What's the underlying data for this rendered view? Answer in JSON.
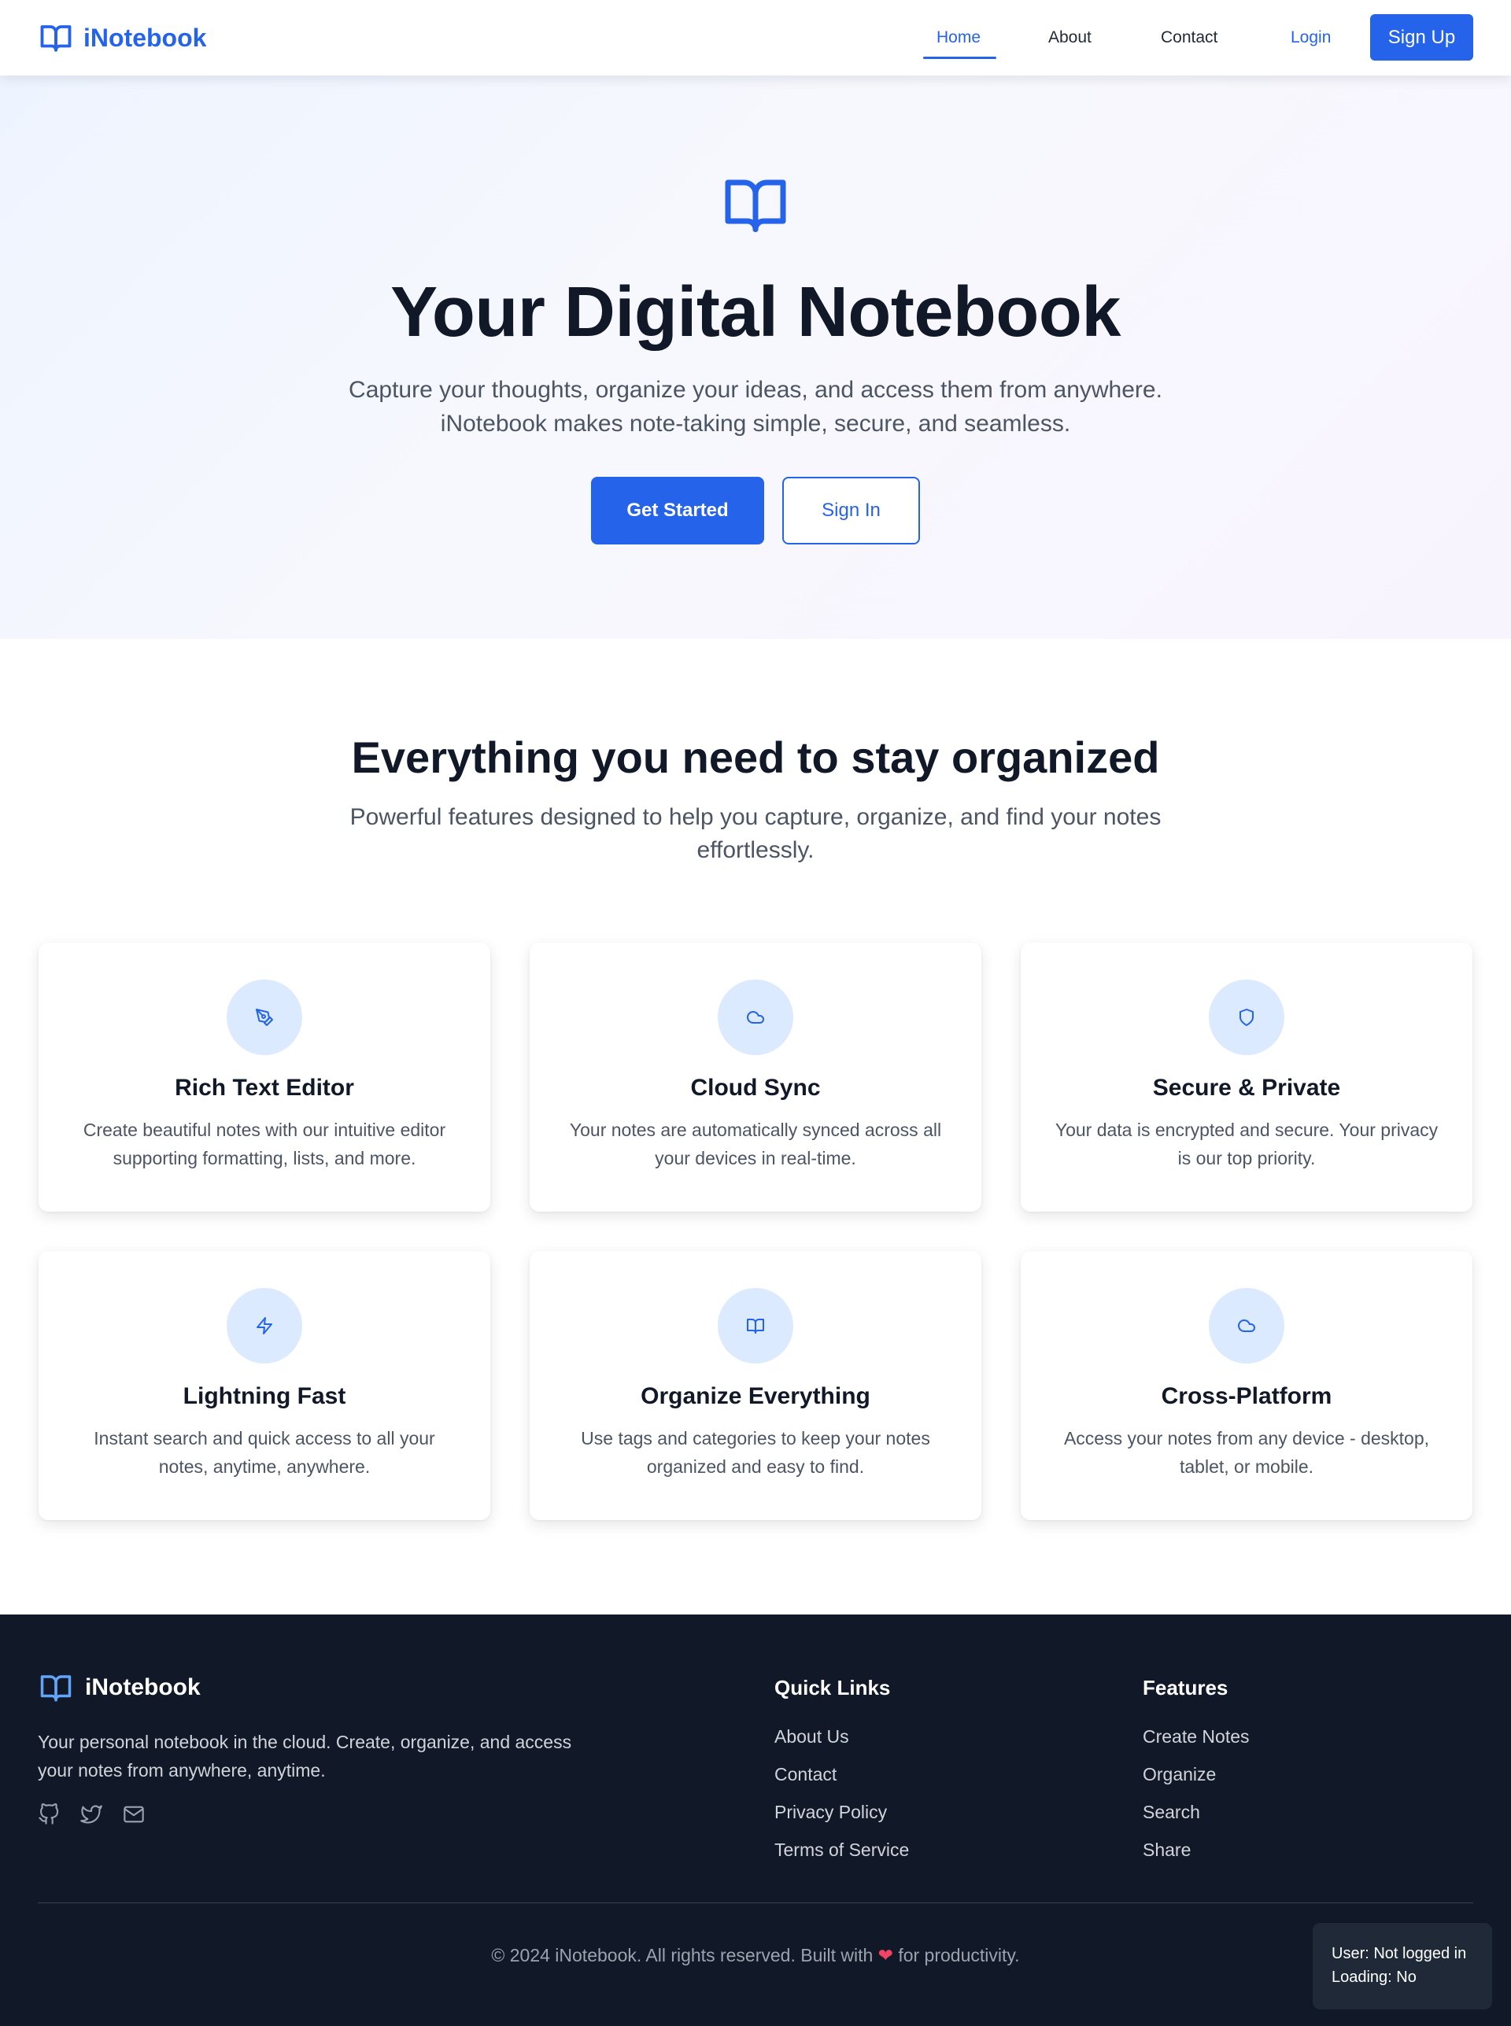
{
  "nav": {
    "brand": "iNotebook",
    "links": [
      {
        "label": "Home",
        "active": true
      },
      {
        "label": "About",
        "active": false
      },
      {
        "label": "Contact",
        "active": false
      }
    ],
    "login_label": "Login",
    "signup_label": "Sign Up"
  },
  "hero": {
    "icon": "book-open-icon",
    "title": "Your Digital Notebook",
    "subtitle_line1": "Capture your thoughts, organize your ideas, and access them from anywhere.",
    "subtitle_line2": "iNotebook makes note-taking simple, secure, and seamless.",
    "primary_button": "Get Started",
    "secondary_button": "Sign In"
  },
  "features": {
    "title": "Everything you need to stay organized",
    "subtitle": "Powerful features designed to help you capture, organize, and find your notes effortlessly.",
    "cards": [
      {
        "icon": "pen-tool-icon",
        "title": "Rich Text Editor",
        "description": "Create beautiful notes with our intuitive editor supporting formatting, lists, and more."
      },
      {
        "icon": "cloud-icon",
        "title": "Cloud Sync",
        "description": "Your notes are automatically synced across all your devices in real-time."
      },
      {
        "icon": "shield-icon",
        "title": "Secure & Private",
        "description": "Your data is encrypted and secure. Your privacy is our top priority."
      },
      {
        "icon": "zap-icon",
        "title": "Lightning Fast",
        "description": "Instant search and quick access to all your notes, anytime, anywhere."
      },
      {
        "icon": "book-open-icon",
        "title": "Organize Everything",
        "description": "Use tags and categories to keep your notes organized and easy to find."
      },
      {
        "icon": "cloud-icon",
        "title": "Cross-Platform",
        "description": "Access your notes from any device - desktop, tablet, or mobile."
      }
    ]
  },
  "footer": {
    "brand": "iNotebook",
    "description": "Your personal notebook in the cloud. Create, organize, and access your notes from anywhere, anytime.",
    "social": [
      "github-icon",
      "twitter-icon",
      "mail-icon"
    ],
    "quick_links": {
      "title": "Quick Links",
      "items": [
        "About Us",
        "Contact",
        "Privacy Policy",
        "Terms of Service"
      ]
    },
    "features": {
      "title": "Features",
      "items": [
        "Create Notes",
        "Organize",
        "Search",
        "Share"
      ]
    },
    "copyright_pre": "© 2024 iNotebook. All rights reserved. Built with",
    "copyright_heart": "❤",
    "copyright_post": "for productivity."
  },
  "status": {
    "user": "User: Not logged in",
    "loading": "Loading: No"
  },
  "colors": {
    "accent": "#2563eb",
    "dark": "#111827",
    "icon_bg": "#dbeafe"
  }
}
